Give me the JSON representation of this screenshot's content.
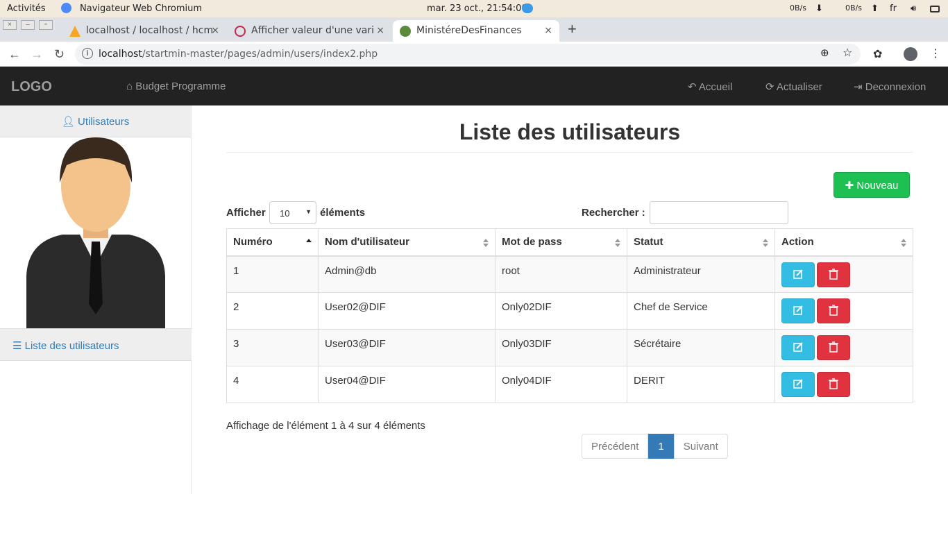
{
  "system": {
    "activities": "Activités",
    "app": "Navigateur Web Chromium",
    "clock": "mar. 23 oct., 21:54:00",
    "net_down": "0B/s",
    "net_up": "0B/s",
    "lang": "fr"
  },
  "tabs": [
    {
      "title": "localhost / localhost / hcm",
      "close": "×"
    },
    {
      "title": "Afficher valeur d'une vari",
      "close": "×"
    },
    {
      "title": "MinistéreDesFinances",
      "close": "×"
    }
  ],
  "url": {
    "host": "localhost",
    "path": "/startmin-master/pages/admin/users/index2.php"
  },
  "topnav": {
    "logo": "LOGO",
    "brand": "Budget Programme",
    "accueil": "Accueil",
    "actualiser": "Actualiser",
    "deconnexion": "Deconnexion"
  },
  "sidebar": {
    "header": "Utilisateurs",
    "item": "Liste des utilisateurs"
  },
  "main": {
    "title": "Liste des utilisateurs",
    "new_button": "Nouveau",
    "afficher": "Afficher",
    "length_value": "10",
    "elements": "éléments",
    "search_label": "Rechercher :",
    "columns": [
      "Numéro",
      "Nom d'utilisateur",
      "Mot de pass",
      "Statut",
      "Action"
    ],
    "rows": [
      [
        "1",
        "Admin@db",
        "root",
        "Administrateur"
      ],
      [
        "2",
        "User02@DIF",
        "Only02DIF",
        "Chef de Service"
      ],
      [
        "3",
        "User03@DIF",
        "Only03DIF",
        "Sécrétaire"
      ],
      [
        "4",
        "User04@DIF",
        "Only04DIF",
        "DERIT"
      ]
    ],
    "info": "Affichage de l'élément 1 à 4 sur 4 éléments",
    "pager": {
      "prev": "Précédent",
      "page": "1",
      "next": "Suivant"
    }
  },
  "colors": {
    "navbar": "#222222",
    "link": "#337ab7",
    "success": "#1ec051",
    "info": "#34bde2",
    "danger": "#e1323f"
  }
}
